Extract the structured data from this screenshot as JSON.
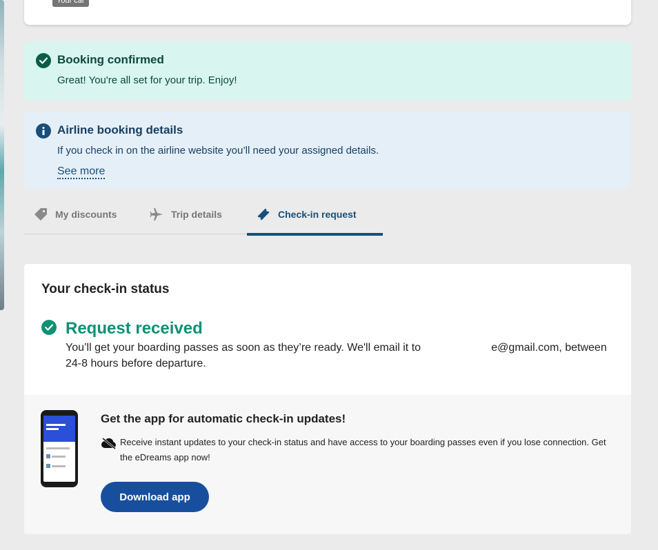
{
  "top_card": {
    "badge": "Your car"
  },
  "banners": {
    "confirmed": {
      "icon": "check-circle-icon",
      "title": "Booking confirmed",
      "text": "Great! You're all set for your trip. Enjoy!",
      "bg_color": "#d8f5f0"
    },
    "airline": {
      "icon": "info-circle-icon",
      "title": "Airline booking details",
      "text": "If you check in on the airline website you’ll need your assigned details.",
      "link": "See more",
      "bg_color": "#e5eff8"
    }
  },
  "tabs": [
    {
      "label": "My discounts",
      "icon": "tag-icon",
      "active": false
    },
    {
      "label": "Trip details",
      "icon": "plane-icon",
      "active": false
    },
    {
      "label": "Check-in request",
      "icon": "ticket-icon",
      "active": true
    }
  ],
  "checkin": {
    "heading": "Your check-in status",
    "status_icon": "check-circle-icon",
    "status_title": "Request received",
    "status_text": "You’ll get your boarding passes as soon as they’re ready. We'll email it to                       e@gmail.com, between 24-8 hours before departure."
  },
  "app_promo": {
    "title": "Get the app for automatic check-in updates!",
    "desc_icon": "cloud-offline-icon",
    "description": "Receive instant updates to your check-in status and have access to your boarding passes even if you lose connection. Get the eDreams app now!",
    "button": "Download app"
  },
  "colors": {
    "accent": "#174f7a",
    "success": "#0f9174",
    "button": "#174f9e"
  }
}
